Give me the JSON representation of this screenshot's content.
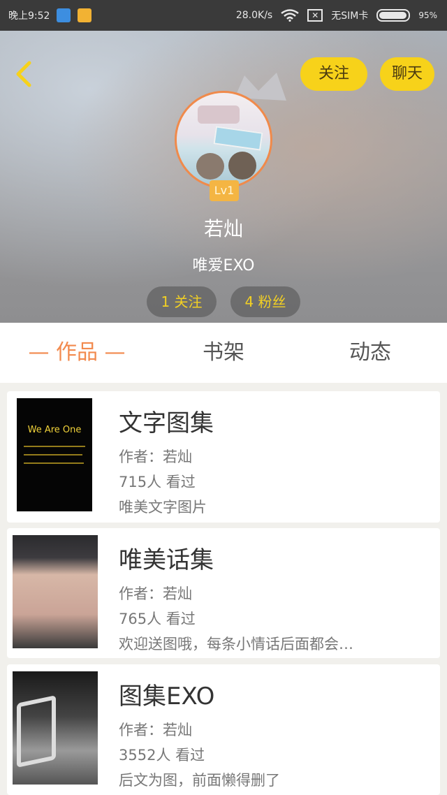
{
  "status_bar": {
    "time": "晚上9:52",
    "network_speed": "28.0K/s",
    "sim": "无SIM卡",
    "battery": "95%"
  },
  "profile": {
    "follow_label": "关注",
    "chat_label": "聊天",
    "level": "Lv1",
    "username": "若灿",
    "signature": "唯爱EXO",
    "following": "1 关注",
    "fans": "4 粉丝"
  },
  "tabs": [
    {
      "label": "— 作品 —",
      "active": true
    },
    {
      "label": "书架",
      "active": false
    },
    {
      "label": "动态",
      "active": false
    }
  ],
  "works": [
    {
      "title": "文字图集",
      "author": "作者：若灿",
      "views": "715人 看过",
      "desc": "唯美文字图片",
      "cover_text": "We Are One"
    },
    {
      "title": "唯美话集",
      "author": "作者：若灿",
      "views": "765人 看过",
      "desc": "欢迎送图哦，每条小情话后面都会…"
    },
    {
      "title": "图集EXO",
      "author": "作者：若灿",
      "views": "3552人 看过",
      "desc": "后文为图，前面懒得删了"
    }
  ],
  "colors": {
    "accent_orange": "#f28a4e",
    "button_yellow": "#f7d21a",
    "stat_text_yellow": "#f2d024"
  }
}
